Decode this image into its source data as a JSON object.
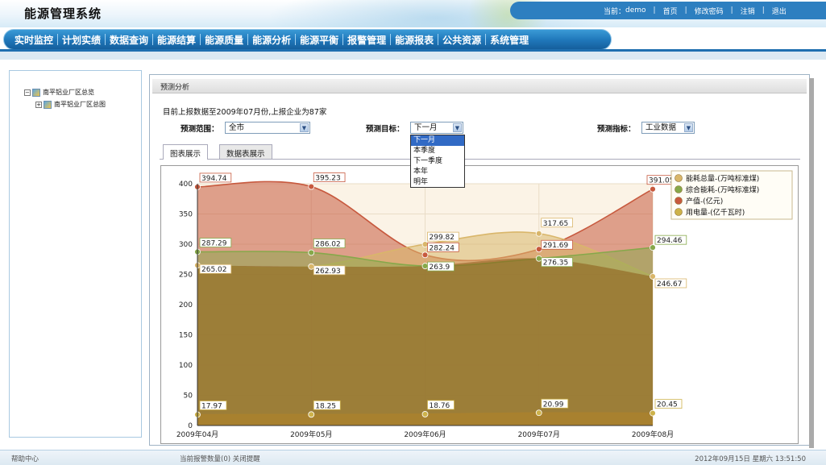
{
  "app": {
    "title": "能源管理系统"
  },
  "user_bar": {
    "current_label": "当前：",
    "username": "demo",
    "links": [
      "首页",
      "修改密码",
      "注销",
      "退出"
    ]
  },
  "nav": [
    "实时监控",
    "计划实绩",
    "数据查询",
    "能源结算",
    "能源质量",
    "能源分析",
    "能源平衡",
    "报警管理",
    "能源报表",
    "公共资源",
    "系统管理"
  ],
  "tree": [
    {
      "label": "南平铝业厂区总览"
    },
    {
      "label": "南平铝业厂区总图"
    }
  ],
  "panel": {
    "title": "预测分析",
    "report_note": "目前上报数据至2009年07月份,上报企业为87家",
    "controls": {
      "range_label": "预测范围：",
      "range_value": "全市",
      "target_label": "预测目标：",
      "target_value": "下一月",
      "target_options": [
        "下一月",
        "本季度",
        "下一季度",
        "本年",
        "明年"
      ],
      "indicator_label": "预测指标：",
      "indicator_value": "工业数据"
    },
    "tabs": [
      "图表展示",
      "数据表展示"
    ]
  },
  "chart_data": {
    "type": "area",
    "categories": [
      "2009年04月",
      "2009年05月",
      "2009年06月",
      "2009年07月",
      "2009年08月"
    ],
    "ylim": [
      0,
      400
    ],
    "yticks": [
      0,
      50,
      100,
      150,
      200,
      250,
      300,
      350,
      400
    ],
    "legend_position": "top-right",
    "series": [
      {
        "name": "能耗总量-(万吨标准煤)",
        "color": "#d9b66a",
        "values": [
          265.02,
          262.93,
          299.82,
          317.65,
          246.67
        ]
      },
      {
        "name": "综合能耗-(万吨标准煤)",
        "color": "#86a84a",
        "values": [
          287.29,
          286.02,
          263.9,
          276.35,
          294.46
        ]
      },
      {
        "name": "产值-(亿元)",
        "color": "#c7593e",
        "values": [
          394.74,
          395.23,
          282.24,
          291.69,
          391.05
        ]
      },
      {
        "name": "用电量-(亿千瓦时)",
        "color": "#cdb24a",
        "values": [
          17.97,
          18.25,
          18.76,
          20.99,
          20.45
        ]
      }
    ]
  },
  "footer": {
    "help": "帮助中心",
    "alarm_text": "当前报警数量(0)",
    "close_remind": "关闭提醒",
    "datetime": "2012年09月15日 星期六 13:51:50"
  },
  "colors": {
    "nav_blue": "#1f76b9",
    "header_bar": "#2d7fc0"
  }
}
